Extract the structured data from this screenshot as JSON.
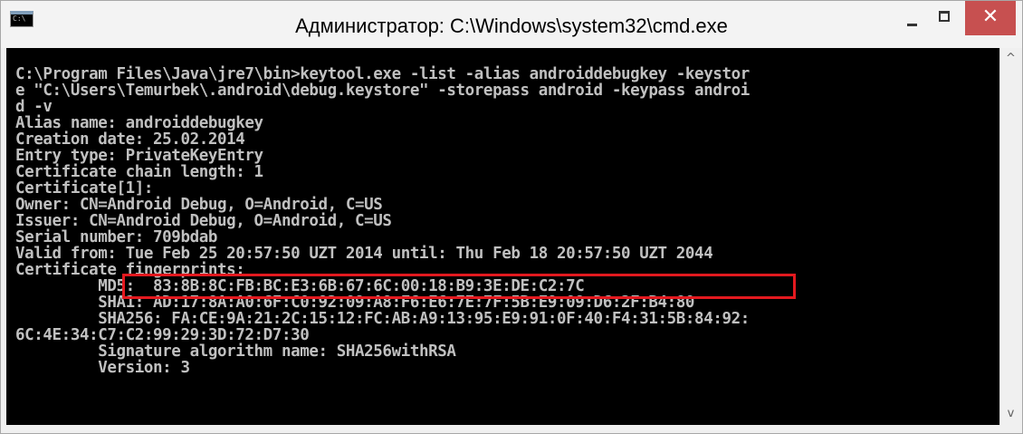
{
  "window": {
    "title": "Администратор: C:\\Windows\\system32\\cmd.exe",
    "icon_text": "C:\\",
    "icon_name": "cmd-icon"
  },
  "controls": {
    "minimize_icon": "minimize-icon",
    "maximize_icon": "maximize-icon",
    "close_icon": "close-icon",
    "close_glyph": "✕",
    "close_color": "#c75050"
  },
  "console": {
    "lines": [
      "C:\\Program Files\\Java\\jre7\\bin>keytool.exe -list -alias androiddebugkey -keystor",
      "e \"C:\\Users\\Temurbek\\.android\\debug.keystore\" -storepass android -keypass androi",
      "d -v",
      "Alias name: androiddebugkey",
      "Creation date: 25.02.2014",
      "Entry type: PrivateKeyEntry",
      "Certificate chain length: 1",
      "Certificate[1]:",
      "Owner: CN=Android Debug, O=Android, C=US",
      "Issuer: CN=Android Debug, O=Android, C=US",
      "Serial number: 709bdab",
      "Valid from: Tue Feb 25 20:57:50 UZT 2014 until: Thu Feb 18 20:57:50 UZT 2044",
      "Certificate fingerprints:",
      "         MD5:  83:8B:8C:FB:BC:E3:6B:67:6C:00:18:B9:3E:DE:C2:7C",
      "         SHA1: AD:17:8A:A0:6F:C0:92:09:A8:F6:E6:7E:7F:5B:E9:09:D6:2F:B4:80",
      "         SHA256: FA:CE:9A:21:2C:15:12:FC:AB:A9:13:95:E9:91:0F:40:F4:31:5B:84:92:",
      "6C:4E:34:C7:C2:99:29:3D:72:D7:30",
      "         Signature algorithm name: SHA256withRSA",
      "         Version: 3"
    ],
    "text_color": "#c0c0c0",
    "background": "#000000",
    "highlight_color": "#e3191f"
  },
  "scrollbar": {
    "up_glyph": "^",
    "down_glyph": "v"
  }
}
